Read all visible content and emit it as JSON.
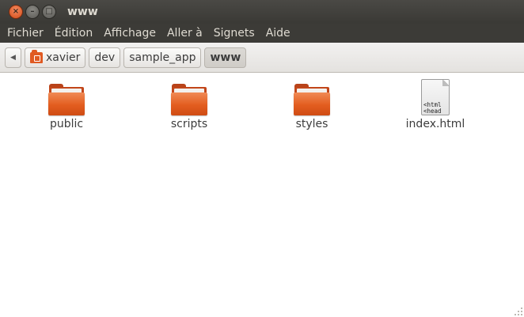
{
  "window": {
    "title": "www",
    "buttons": {
      "close": "×",
      "minimize": "–",
      "maximize": "□"
    }
  },
  "menubar": {
    "items": [
      "Fichier",
      "Édition",
      "Affichage",
      "Aller à",
      "Signets",
      "Aide"
    ]
  },
  "pathbar": {
    "back_icon": "◀",
    "crumbs": [
      {
        "label": "xavier",
        "icon": "home-folder-icon"
      },
      {
        "label": "dev"
      },
      {
        "label": "sample_app"
      },
      {
        "label": "www",
        "active": true
      }
    ]
  },
  "files": [
    {
      "name": "public",
      "type": "folder"
    },
    {
      "name": "scripts",
      "type": "folder"
    },
    {
      "name": "styles",
      "type": "folder"
    },
    {
      "name": "index.html",
      "type": "html-file",
      "preview": "<!DOC\n<html\n<head\n  <me"
    }
  ],
  "colors": {
    "folder_orange": "#e35d1f",
    "titlebar": "#3c3b37",
    "accent": "#dd4814"
  }
}
